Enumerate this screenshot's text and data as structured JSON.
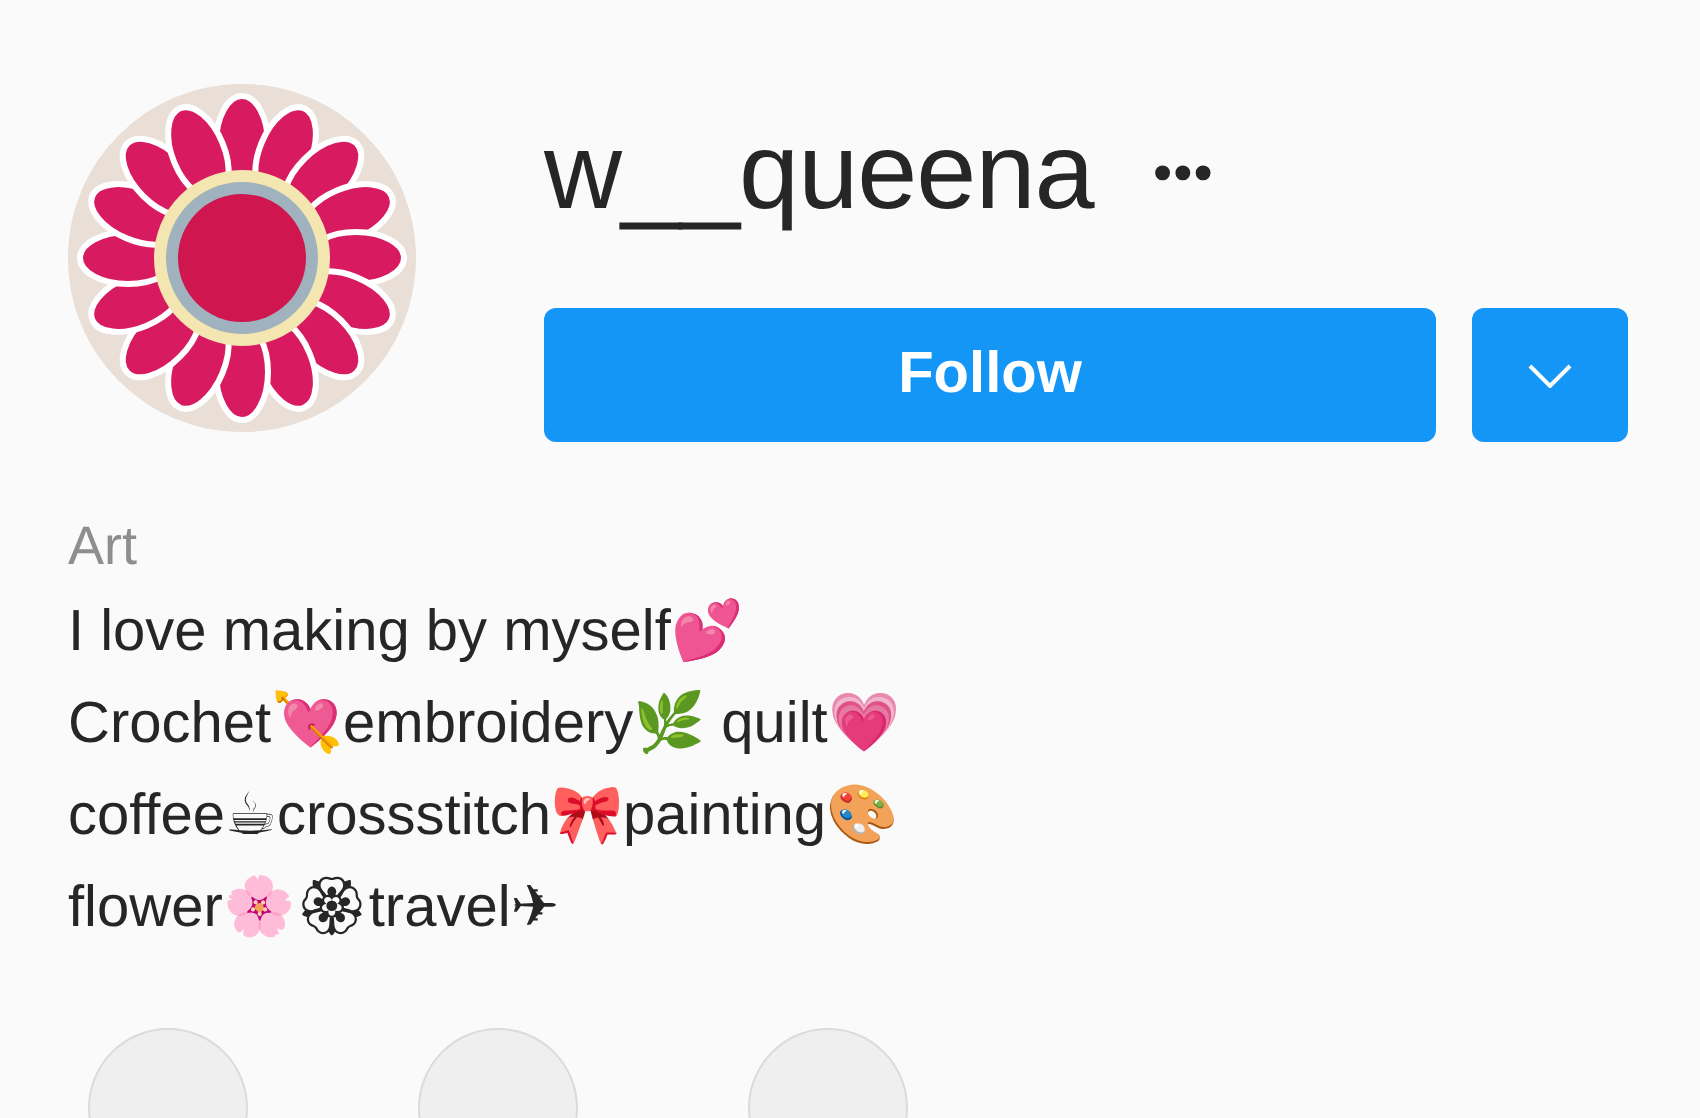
{
  "profile": {
    "username": "w__queena",
    "options_icon": "•••",
    "follow_button": "Follow"
  },
  "bio": {
    "category": "Art",
    "lines": [
      "I love making by myself💕",
      "Crochet💘embroidery🌿 quilt💗",
      "coffee☕crossstitch🎀painting🎨",
      "flower🌸🏵travel✈"
    ]
  },
  "highlights": [
    {
      "kind": "circle"
    },
    {
      "kind": "circle"
    },
    {
      "kind": "circle"
    }
  ]
}
